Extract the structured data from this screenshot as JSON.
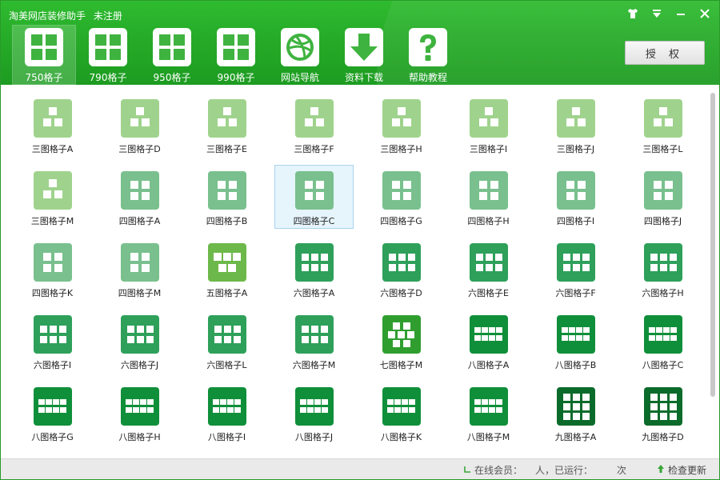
{
  "window": {
    "title": "淘美网店装修助手",
    "registration": "未注册",
    "controls": [
      "skin-icon",
      "menu-icon",
      "minimize-icon",
      "close-icon"
    ]
  },
  "tabs": [
    {
      "label": "750格子",
      "icon": "grid-icon",
      "active": true
    },
    {
      "label": "790格子",
      "icon": "grid-icon",
      "active": false
    },
    {
      "label": "950格子",
      "icon": "grid-icon",
      "active": false
    },
    {
      "label": "990格子",
      "icon": "grid-icon",
      "active": false
    },
    {
      "label": "网站导航",
      "icon": "dribbble-icon",
      "active": false
    },
    {
      "label": "资料下载",
      "icon": "download-icon",
      "active": false
    },
    {
      "label": "帮助教程",
      "icon": "help-icon",
      "active": false
    }
  ],
  "auth_button": "授 权",
  "colors": {
    "header": "#26ab28",
    "three": "#9fd38d",
    "four": "#79c08e",
    "five": "#6db84a",
    "six": "#2ea05a",
    "seven": "#2f9e2f",
    "eight": "#0f8f3a",
    "nine": "#0b6b2b"
  },
  "grid": {
    "selected_index": 11,
    "items": [
      {
        "label": "三图格子A",
        "kind": "three"
      },
      {
        "label": "三图格子D",
        "kind": "three"
      },
      {
        "label": "三图格子E",
        "kind": "three"
      },
      {
        "label": "三图格子F",
        "kind": "three"
      },
      {
        "label": "三图格子H",
        "kind": "three"
      },
      {
        "label": "三图格子I",
        "kind": "three"
      },
      {
        "label": "三图格子J",
        "kind": "three"
      },
      {
        "label": "三图格子L",
        "kind": "three"
      },
      {
        "label": "三图格子M",
        "kind": "three"
      },
      {
        "label": "四图格子A",
        "kind": "four"
      },
      {
        "label": "四图格子B",
        "kind": "four"
      },
      {
        "label": "四图格子C",
        "kind": "four"
      },
      {
        "label": "四图格子G",
        "kind": "four"
      },
      {
        "label": "四图格子H",
        "kind": "four"
      },
      {
        "label": "四图格子I",
        "kind": "four"
      },
      {
        "label": "四图格子J",
        "kind": "four"
      },
      {
        "label": "四图格子K",
        "kind": "four"
      },
      {
        "label": "四图格子M",
        "kind": "four"
      },
      {
        "label": "五图格子A",
        "kind": "five"
      },
      {
        "label": "六图格子A",
        "kind": "six"
      },
      {
        "label": "六图格子D",
        "kind": "six"
      },
      {
        "label": "六图格子E",
        "kind": "six"
      },
      {
        "label": "六图格子F",
        "kind": "six"
      },
      {
        "label": "六图格子H",
        "kind": "six"
      },
      {
        "label": "六图格子I",
        "kind": "six"
      },
      {
        "label": "六图格子J",
        "kind": "six"
      },
      {
        "label": "六图格子L",
        "kind": "six"
      },
      {
        "label": "六图格子M",
        "kind": "six"
      },
      {
        "label": "七图格子M",
        "kind": "seven"
      },
      {
        "label": "八图格子A",
        "kind": "eight"
      },
      {
        "label": "八图格子B",
        "kind": "eight"
      },
      {
        "label": "八图格子C",
        "kind": "eight"
      },
      {
        "label": "八图格子G",
        "kind": "eight"
      },
      {
        "label": "八图格子H",
        "kind": "eight"
      },
      {
        "label": "八图格子I",
        "kind": "eight"
      },
      {
        "label": "八图格子J",
        "kind": "eight"
      },
      {
        "label": "八图格子K",
        "kind": "eight"
      },
      {
        "label": "八图格子M",
        "kind": "eight"
      },
      {
        "label": "九图格子A",
        "kind": "nine"
      },
      {
        "label": "九图格子D",
        "kind": "nine"
      }
    ]
  },
  "status": {
    "online": "在线会员：",
    "unit_people": "人，已运行：",
    "unit_times": "次",
    "update": "检查更新"
  }
}
